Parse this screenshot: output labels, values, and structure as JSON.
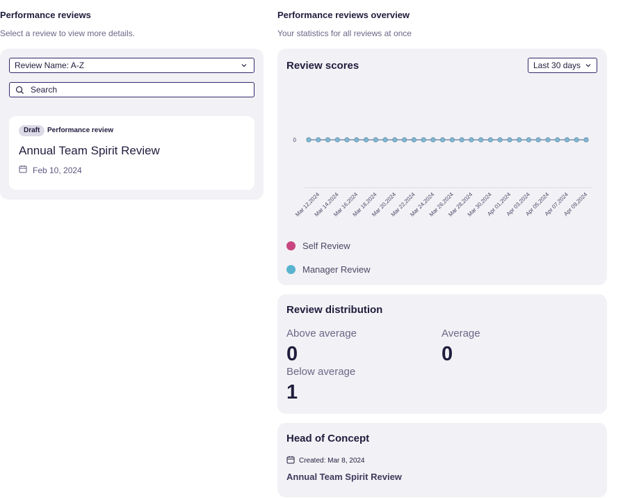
{
  "left": {
    "title": "Performance reviews",
    "subtitle": "Select a review to view more details.",
    "sort": {
      "value": "Review Name: A-Z"
    },
    "search": {
      "placeholder": "Search"
    },
    "cards": [
      {
        "badge": "Draft",
        "type": "Performance review",
        "title": "Annual Team Spirit Review",
        "date": "Feb 10, 2024"
      }
    ]
  },
  "right": {
    "title": "Performance reviews overview",
    "subtitle": "Your statistics for all reviews at once",
    "scores": {
      "heading": "Review scores",
      "range": "Last 30 days"
    },
    "distribution": {
      "heading": "Review distribution",
      "above_label": "Above average",
      "above_value": "0",
      "average_label": "Average",
      "average_value": "0",
      "below_label": "Below average",
      "below_value": "1"
    },
    "head": {
      "heading": "Head of Concept",
      "created": "Created: Mar 8, 2024",
      "review": "Annual Team Spirit Review"
    }
  },
  "colors": {
    "accent": "#2f2a6b",
    "self": "#c8457f",
    "manager": "#5ab4cf",
    "panel": "#f2f1f5"
  },
  "chart_data": {
    "type": "line",
    "x": [
      "Mar 11, 2024",
      "Mar 12, 2024",
      "Mar 13, 2024",
      "Mar 14, 2024",
      "Mar 15, 2024",
      "Mar 16, 2024",
      "Mar 17, 2024",
      "Mar 18, 2024",
      "Mar 19, 2024",
      "Mar 20, 2024",
      "Mar 21, 2024",
      "Mar 22, 2024",
      "Mar 23, 2024",
      "Mar 24, 2024",
      "Mar 25, 2024",
      "Mar 26, 2024",
      "Mar 27, 2024",
      "Mar 28, 2024",
      "Mar 29, 2024",
      "Mar 30, 2024",
      "Mar 31, 2024",
      "Apr 01, 2024",
      "Apr 02, 2024",
      "Apr 03, 2024",
      "Apr 04, 2024",
      "Apr 05, 2024",
      "Apr 06, 2024",
      "Apr 07, 2024",
      "Apr 08, 2024",
      "Apr 09, 2024"
    ],
    "tick_labels": [
      "Mar 12,2024",
      "Mar 14,2024",
      "Mar 16,2024",
      "Mar 18,2024",
      "Mar 20,2024",
      "Mar 22,2024",
      "Mar 24,2024",
      "Mar 26,2024",
      "Mar 28,2024",
      "Mar 30,2024",
      "Apr 01,2024",
      "Apr 03,2024",
      "Apr 05,2024",
      "Apr 07,2024",
      "Apr 09,2024"
    ],
    "yticks": [
      "0"
    ],
    "series": [
      {
        "name": "Self Review",
        "color": "#c8457f",
        "values": [
          0,
          0,
          0,
          0,
          0,
          0,
          0,
          0,
          0,
          0,
          0,
          0,
          0,
          0,
          0,
          0,
          0,
          0,
          0,
          0,
          0,
          0,
          0,
          0,
          0,
          0,
          0,
          0,
          0,
          0
        ]
      },
      {
        "name": "Manager Review",
        "color": "#5ab4cf",
        "values": [
          0,
          0,
          0,
          0,
          0,
          0,
          0,
          0,
          0,
          0,
          0,
          0,
          0,
          0,
          0,
          0,
          0,
          0,
          0,
          0,
          0,
          0,
          0,
          0,
          0,
          0,
          0,
          0,
          0,
          0
        ]
      }
    ],
    "legend": "bottom-left",
    "grid": false
  }
}
